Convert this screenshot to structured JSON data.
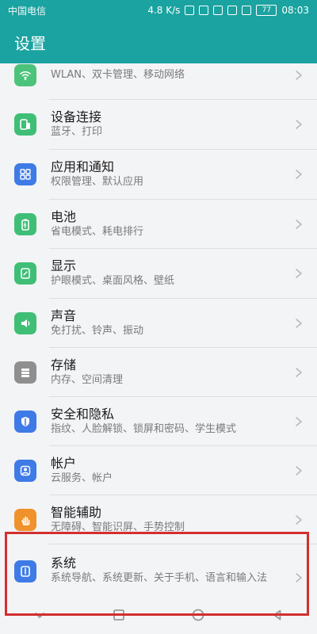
{
  "status": {
    "carrier": "中国电信",
    "speed": "4.8 K/s",
    "time": "08:03",
    "battery": "77"
  },
  "title": "设置",
  "items": [
    {
      "key": "wlan",
      "title": "",
      "subtitle": "WLAN、双卡管理、移动网络",
      "icon": "wifi-icon",
      "color": "#4cc37a"
    },
    {
      "key": "device-connection",
      "title": "设备连接",
      "subtitle": "蓝牙、打印",
      "icon": "device-connection-icon",
      "color": "#3fbf76"
    },
    {
      "key": "apps-notifications",
      "title": "应用和通知",
      "subtitle": "权限管理、默认应用",
      "icon": "apps-icon",
      "color": "#3f7be6"
    },
    {
      "key": "battery",
      "title": "电池",
      "subtitle": "省电模式、耗电排行",
      "icon": "battery-icon",
      "color": "#3fbf76"
    },
    {
      "key": "display",
      "title": "显示",
      "subtitle": "护眼模式、桌面风格、壁纸",
      "icon": "display-icon",
      "color": "#3fbf76"
    },
    {
      "key": "sound",
      "title": "声音",
      "subtitle": "免打扰、铃声、振动",
      "icon": "sound-icon",
      "color": "#3fbf76"
    },
    {
      "key": "storage",
      "title": "存储",
      "subtitle": "内存、空间清理",
      "icon": "storage-icon",
      "color": "#8f8f8f"
    },
    {
      "key": "security-privacy",
      "title": "安全和隐私",
      "subtitle": "指纹、人脸解锁、锁屏和密码、学生模式",
      "icon": "security-icon",
      "color": "#3f7be6"
    },
    {
      "key": "account",
      "title": "帐户",
      "subtitle": "云服务、帐户",
      "icon": "account-icon",
      "color": "#3f7be6"
    },
    {
      "key": "accessibility",
      "title": "智能辅助",
      "subtitle": "无障碍、智能识屏、手势控制",
      "icon": "hand-icon",
      "color": "#f0922c"
    },
    {
      "key": "system",
      "title": "系统",
      "subtitle": "系统导航、系统更新、关于手机、语言和输入法",
      "icon": "info-icon",
      "color": "#3f7be6"
    }
  ],
  "nav": {
    "down": "chevron-down-icon",
    "recent": "square-icon",
    "home": "circle-icon",
    "back": "triangle-back-icon"
  }
}
